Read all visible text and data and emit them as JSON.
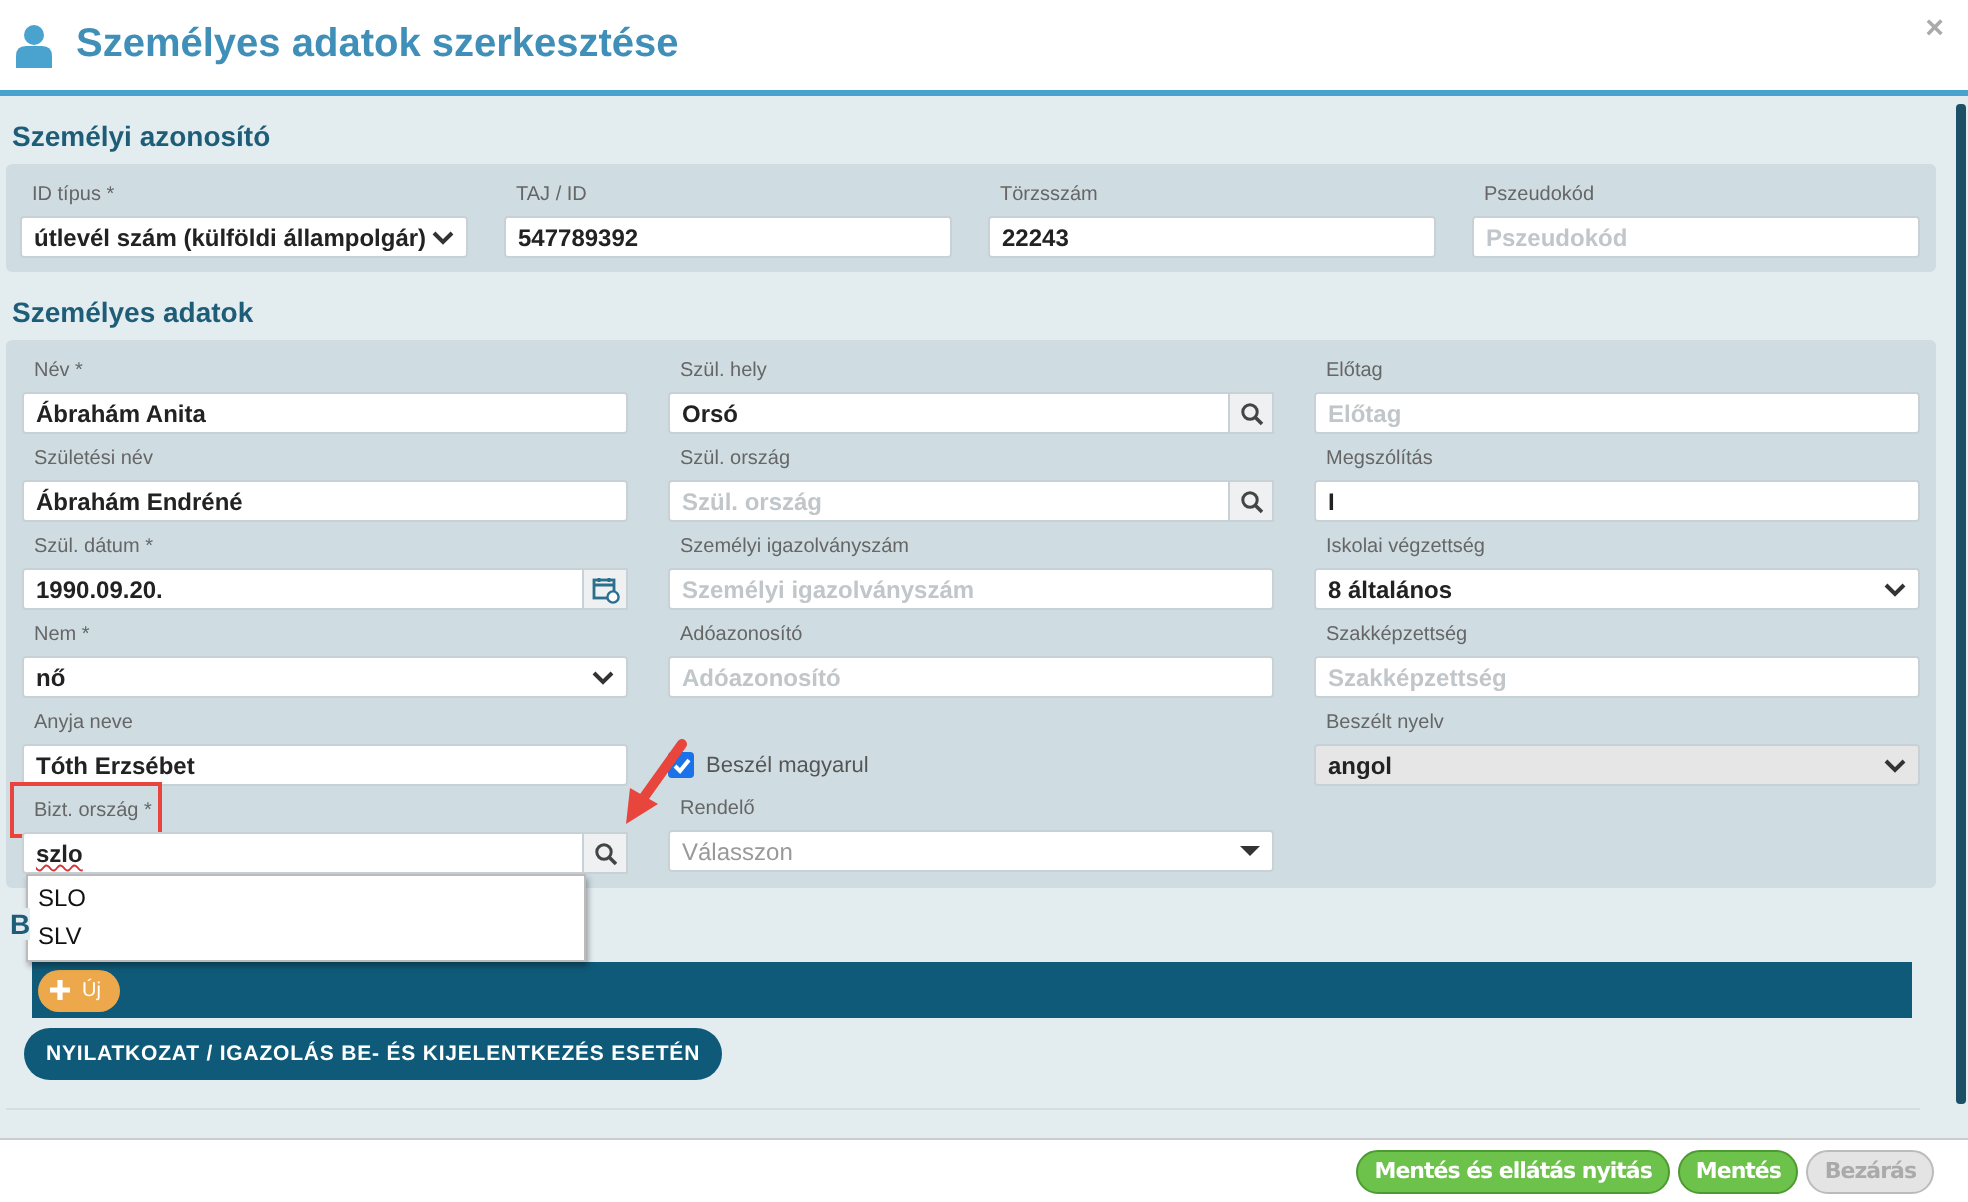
{
  "window": {
    "title": "Személyes adatok szerkesztése",
    "close": "×"
  },
  "sections": [
    {
      "title": "Személyi azonosító",
      "columns": [
        [
          {
            "kind": "select",
            "label": "ID típus *",
            "value": "útlevél szám (külföldi állampolgár)",
            "disabled": false
          }
        ],
        [
          {
            "kind": "text",
            "label": "TAJ / ID",
            "value": "547789392"
          }
        ],
        [
          {
            "kind": "text",
            "label": "Törzsszám",
            "value": "22243"
          }
        ],
        [
          {
            "kind": "text",
            "label": "Pszeudokód",
            "placeholder": "Pszeudokód"
          }
        ]
      ]
    },
    {
      "title": "Személyes adatok",
      "columns": [
        [
          {
            "kind": "text",
            "label": "Név *",
            "value": "Ábrahám Anita"
          },
          {
            "kind": "text",
            "label": "Születési név",
            "value": "Ábrahám Endréné"
          },
          {
            "kind": "date",
            "label": "Szül. dátum *",
            "value": "1990.09.20."
          },
          {
            "kind": "select",
            "label": "Nem *",
            "value": "nő",
            "disabled": false
          },
          {
            "kind": "text",
            "label": "Anyja neve",
            "value": "Tóth Erzsébet"
          },
          {
            "kind": "search",
            "label": "Bizt. ország *",
            "value": "szlo",
            "misspelled": true,
            "highlighted": true,
            "arrow": true,
            "suggestions": [
              "SLO",
              "SLV"
            ]
          }
        ],
        [
          {
            "kind": "search",
            "label": "Szül. hely",
            "value": "Orsó"
          },
          {
            "kind": "search",
            "label": "Szül. ország",
            "placeholder": "Szül. ország"
          },
          {
            "kind": "text",
            "label": "Személyi igazolványszám",
            "placeholder": "Személyi igazolványszám"
          },
          {
            "kind": "text",
            "label": "Adóazonosító",
            "placeholder": "Adóazonosító"
          },
          {
            "kind": "checkbox",
            "label": "Beszél magyarul",
            "checked": true
          },
          {
            "kind": "combo",
            "label": "Rendelő",
            "placeholder": "Válasszon"
          }
        ],
        [
          {
            "kind": "text",
            "label": "Előtag",
            "placeholder": "Előtag"
          },
          {
            "kind": "text",
            "label": "Megszólítás",
            "value": "I"
          },
          {
            "kind": "select",
            "label": "Iskolai végzettség",
            "value": "8 általános",
            "disabled": false
          },
          {
            "kind": "text",
            "label": "Szakképzettség",
            "placeholder": "Szakképzettség"
          },
          {
            "kind": "select",
            "label": "Beszélt nyelv",
            "value": "angol",
            "disabled": true
          }
        ]
      ]
    },
    {
      "title": "B",
      "toolbar": {
        "new_button": "Új"
      },
      "action_button": "NYILATKOZAT / IGAZOLÁS BE- ÉS KIJELENTKEZÉS ESETÉN"
    }
  ],
  "footer": {
    "buttons": [
      {
        "label": "Mentés és ellátás nyitás",
        "disabled": false
      },
      {
        "label": "Mentés",
        "disabled": false
      },
      {
        "label": "Bezárás",
        "disabled": true
      }
    ]
  }
}
